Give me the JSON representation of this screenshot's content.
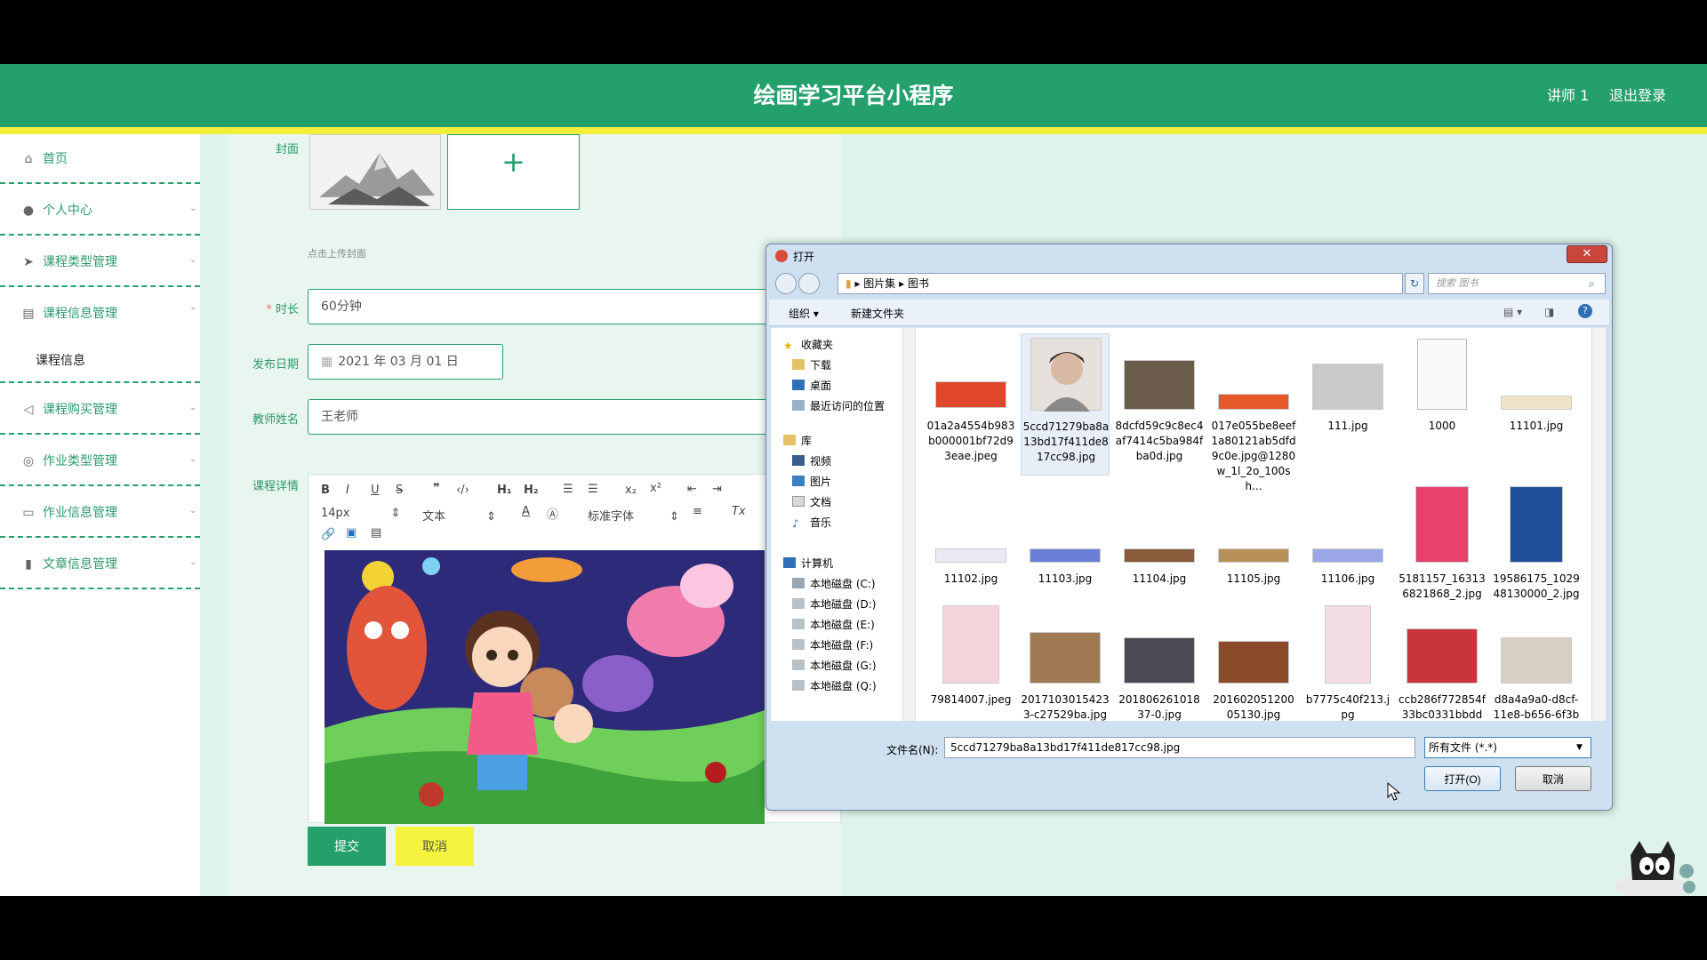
{
  "header": {
    "title": "绘画学习平台小程序",
    "user": "讲师 1",
    "logout": "退出登录"
  },
  "sidebar": {
    "items": [
      {
        "label": "首页",
        "icon": "home-icon"
      },
      {
        "label": "个人中心",
        "icon": "user-icon"
      },
      {
        "label": "课程类型管理",
        "icon": "send-icon"
      },
      {
        "label": "课程信息管理",
        "icon": "book-icon"
      },
      {
        "label": "课程购买管理",
        "icon": "location-arrow-icon"
      },
      {
        "label": "作业类型管理",
        "icon": "compass-icon"
      },
      {
        "label": "作业信息管理",
        "icon": "message-icon"
      },
      {
        "label": "文章信息管理",
        "icon": "bar-chart-icon"
      }
    ],
    "submenu": {
      "label": "课程信息"
    }
  },
  "form": {
    "cover_label": "封面",
    "cover_hint": "点击上传封面",
    "duration_label": "时长",
    "duration_value": "60分钟",
    "date_label": "发布日期",
    "date_value": "2021 年 03 月 01 日",
    "teacher_label": "教师姓名",
    "teacher_value": "王老师",
    "detail_label": "课程详情",
    "editor": {
      "font_size": "14px",
      "block": "文本",
      "font": "标准字体"
    },
    "submit": "提交",
    "cancel": "取消"
  },
  "dialog": {
    "title": "打开",
    "breadcrumb": [
      "图片集",
      "图书"
    ],
    "search_placeholder": "搜索 图书",
    "organize": "组织 ▾",
    "new_folder": "新建文件夹",
    "nav": {
      "favorites": "收藏夹",
      "favorites_items": [
        "下载",
        "桌面",
        "最近访问的位置"
      ],
      "libraries": "库",
      "libraries_items": [
        "视频",
        "图片",
        "文档",
        "音乐"
      ],
      "computer": "计算机",
      "drives": [
        "本地磁盘 (C:)",
        "本地磁盘 (D:)",
        "本地磁盘 (E:)",
        "本地磁盘 (F:)",
        "本地磁盘 (G:)",
        "本地磁盘 (Q:)"
      ]
    },
    "files": [
      "01a2a4554b983b000001bf72d93eae.jpeg",
      "5ccd71279ba8a13bd17f411de817cc98.jpg",
      "8dcfd59c9c8ec4af7414c5ba984fba0d.jpg",
      "017e055be8eef1a80121ab5dfd9c0e.jpg@1280w_1l_2o_100sh...",
      "111.jpg",
      "1000",
      "11101.jpg",
      "11102.jpg",
      "11103.jpg",
      "11104.jpg",
      "11105.jpg",
      "11106.jpg",
      "5181157_163136821868_2.jpg",
      "19586175_102948130000_2.jpg",
      "79814007.jpeg",
      "20171030154233-c27529ba.jpg",
      "201806261018 37-0.jpg",
      "201602051200 05130.jpg",
      "b7775c40f213.jpg",
      "ccb286f772854f33bc0331bbdd",
      "d8a4a9a0-d8cf-11e8-b656-6f3b"
    ],
    "filename_label": "文件名(N):",
    "filename_value": "5ccd71279ba8a13bd17f411de817cc98.jpg",
    "filetype": "所有文件 (*.*)",
    "open": "打开(O)",
    "cancel": "取消",
    "selected_file": "5ccd71279ba8a13bd17f411de817cc98.jpg"
  },
  "colors": {
    "primary": "#23a06b",
    "accent_yellow": "#f2ef3b",
    "background": "#dff3ea"
  }
}
